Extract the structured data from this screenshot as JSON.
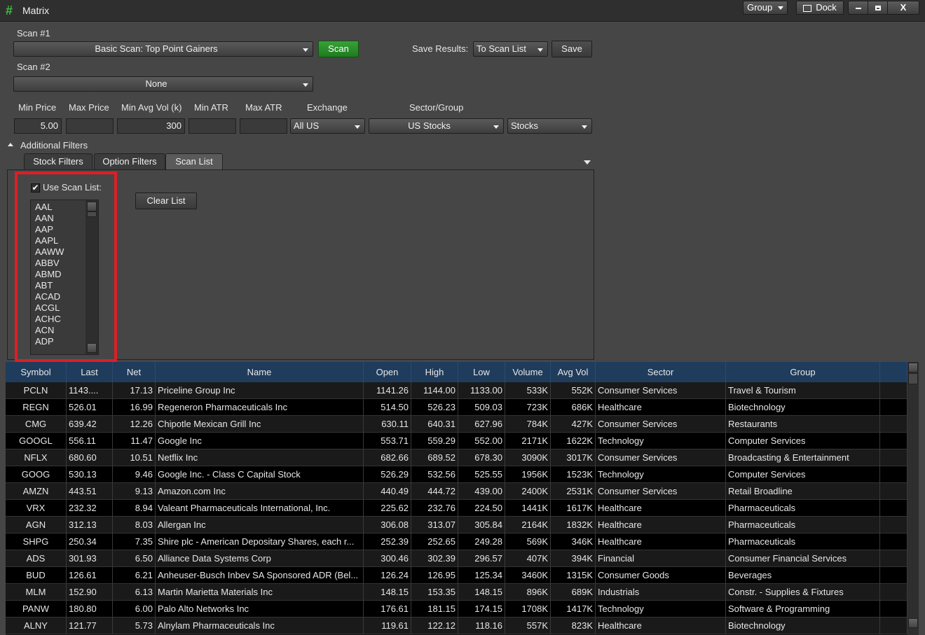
{
  "window": {
    "title": "Matrix",
    "icon": "hash-icon",
    "buttons": {
      "group": "Group",
      "dock": "Dock",
      "minimize": "▁",
      "maximize": "□",
      "close": "X"
    }
  },
  "scan1": {
    "label": "Scan #1",
    "value": "Basic Scan: Top Point Gainers",
    "scan_button": "Scan"
  },
  "scan2": {
    "label": "Scan #2",
    "value": "None"
  },
  "save": {
    "label": "Save Results:",
    "value": "To Scan List",
    "button": "Save"
  },
  "filters": {
    "min_price": {
      "label": "Min Price",
      "value": "5.00"
    },
    "max_price": {
      "label": "Max Price",
      "value": ""
    },
    "min_avg_vol": {
      "label": "Min Avg Vol (k)",
      "value": "300"
    },
    "min_atr": {
      "label": "Min ATR",
      "value": ""
    },
    "max_atr": {
      "label": "Max ATR",
      "value": ""
    },
    "exchange": {
      "label": "Exchange",
      "value": "All US"
    },
    "sector_group": {
      "label": "Sector/Group",
      "value": "US Stocks"
    },
    "type": {
      "value": "Stocks"
    }
  },
  "additional_filters": {
    "label": "Additional Filters"
  },
  "tabs": [
    "Stock Filters",
    "Option Filters",
    "Scan List"
  ],
  "scan_list": {
    "checkbox_label": "Use Scan List:",
    "checked": true,
    "clear_button": "Clear List",
    "items": [
      "AAL",
      "AAN",
      "AAP",
      "AAPL",
      "AAWW",
      "ABBV",
      "ABMD",
      "ABT",
      "ACAD",
      "ACGL",
      "ACHC",
      "ACN",
      "ADP"
    ]
  },
  "grid": {
    "columns": [
      "Symbol",
      "Last",
      "Net",
      "Name",
      "Open",
      "High",
      "Low",
      "Volume",
      "Avg Vol",
      "Sector",
      "Group"
    ],
    "rows": [
      [
        "PCLN",
        "1143....",
        "17.13",
        "Priceline Group Inc",
        "1141.26",
        "1144.00",
        "1133.00",
        "533K",
        "552K",
        "Consumer Services",
        "Travel & Tourism"
      ],
      [
        "REGN",
        "526.01",
        "16.99",
        "Regeneron Pharmaceuticals Inc",
        "514.50",
        "526.23",
        "509.03",
        "723K",
        "686K",
        "Healthcare",
        "Biotechnology"
      ],
      [
        "CMG",
        "639.42",
        "12.26",
        "Chipotle Mexican Grill Inc",
        "630.11",
        "640.31",
        "627.96",
        "784K",
        "427K",
        "Consumer Services",
        "Restaurants"
      ],
      [
        "GOOGL",
        "556.11",
        "11.47",
        "Google Inc",
        "553.71",
        "559.29",
        "552.00",
        "2171K",
        "1622K",
        "Technology",
        "Computer Services"
      ],
      [
        "NFLX",
        "680.60",
        "10.51",
        "Netflix Inc",
        "682.66",
        "689.52",
        "678.30",
        "3090K",
        "3017K",
        "Consumer Services",
        "Broadcasting & Entertainment"
      ],
      [
        "GOOG",
        "530.13",
        "9.46",
        "Google Inc. - Class C Capital Stock",
        "526.29",
        "532.56",
        "525.55",
        "1956K",
        "1523K",
        "Technology",
        "Computer Services"
      ],
      [
        "AMZN",
        "443.51",
        "9.13",
        "Amazon.com Inc",
        "440.49",
        "444.72",
        "439.00",
        "2400K",
        "2531K",
        "Consumer Services",
        "Retail Broadline"
      ],
      [
        "VRX",
        "232.32",
        "8.94",
        "Valeant Pharmaceuticals International, Inc.",
        "225.62",
        "232.76",
        "224.50",
        "1441K",
        "1617K",
        "Healthcare",
        "Pharmaceuticals"
      ],
      [
        "AGN",
        "312.13",
        "8.03",
        "Allergan Inc",
        "306.08",
        "313.07",
        "305.84",
        "2164K",
        "1832K",
        "Healthcare",
        "Pharmaceuticals"
      ],
      [
        "SHPG",
        "250.34",
        "7.35",
        "Shire plc - American Depositary Shares, each r...",
        "252.39",
        "252.65",
        "249.28",
        "569K",
        "346K",
        "Healthcare",
        "Pharmaceuticals"
      ],
      [
        "ADS",
        "301.93",
        "6.50",
        "Alliance Data Systems Corp",
        "300.46",
        "302.39",
        "296.57",
        "407K",
        "394K",
        "Financial",
        "Consumer Financial Services"
      ],
      [
        "BUD",
        "126.61",
        "6.21",
        "Anheuser-Busch Inbev SA Sponsored ADR (Bel...",
        "126.24",
        "126.95",
        "125.34",
        "3460K",
        "1315K",
        "Consumer Goods",
        "Beverages"
      ],
      [
        "MLM",
        "152.90",
        "6.13",
        "Martin Marietta Materials Inc",
        "148.15",
        "153.35",
        "148.15",
        "896K",
        "689K",
        "Industrials",
        "Constr. - Supplies & Fixtures"
      ],
      [
        "PANW",
        "180.80",
        "6.00",
        "Palo Alto Networks Inc",
        "176.61",
        "181.15",
        "174.15",
        "1708K",
        "1417K",
        "Technology",
        "Software & Programming"
      ],
      [
        "ALNY",
        "121.77",
        "5.73",
        "Alnylam Pharmaceuticals Inc",
        "119.61",
        "122.12",
        "118.16",
        "557K",
        "823K",
        "Healthcare",
        "Biotechnology"
      ]
    ]
  },
  "colors": {
    "accent_green": "#2a8f2a",
    "highlight_red": "#dc1f27",
    "grid_header": "#1f3c5c"
  }
}
